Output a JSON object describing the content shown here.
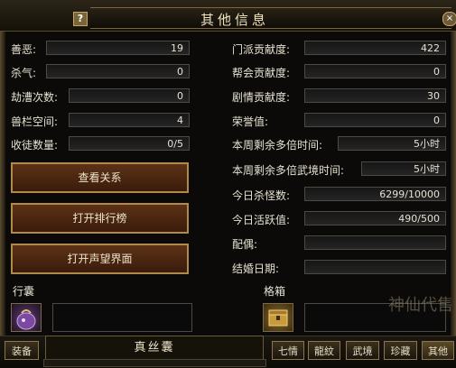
{
  "window": {
    "title": "其他信息",
    "help_label": "?",
    "close_label": "×"
  },
  "left_stats": [
    {
      "label": "善恶:",
      "value": "19"
    },
    {
      "label": "杀气:",
      "value": "0"
    },
    {
      "label": "劫漕次数:",
      "value": "0"
    },
    {
      "label": "兽栏空间:",
      "value": "4"
    },
    {
      "label": "收徒数量:",
      "value": "0/5"
    }
  ],
  "right_stats": [
    {
      "label": "门派贡献度:",
      "value": "422"
    },
    {
      "label": "帮会贡献度:",
      "value": "0"
    },
    {
      "label": "剧情贡献度:",
      "value": "30"
    },
    {
      "label": "荣誉值:",
      "value": "0"
    },
    {
      "label": "本周剩余多倍时间:",
      "value": "5小时"
    },
    {
      "label": "本周剩余多倍武境时间:",
      "value": "5小时"
    },
    {
      "label": "今日杀怪数:",
      "value": "6299/10000"
    },
    {
      "label": "今日活跃值:",
      "value": "490/500"
    },
    {
      "label": "配偶:",
      "value": ""
    },
    {
      "label": "结婚日期:",
      "value": ""
    }
  ],
  "buttons": {
    "relations": "查看关系",
    "ranking": "打开排行榜",
    "reputation": "打开声望界面"
  },
  "sections": {
    "bag": "行囊",
    "grid_box": "格箱"
  },
  "tooltip": {
    "title": "真丝囊"
  },
  "tabs": {
    "equip": "装备",
    "seven": "七情",
    "dragon": "龍紋",
    "wujing": "武境",
    "treasure": "珍藏",
    "other": "其他"
  },
  "watermark": "神仙代售",
  "colors": {
    "button_bg": "#4a260f",
    "button_border": "#b08a4a",
    "text": "#e6e1d2"
  }
}
